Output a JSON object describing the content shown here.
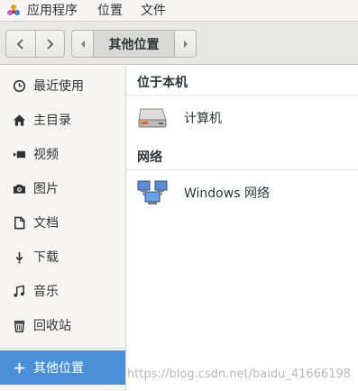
{
  "menubar": {
    "items": [
      "应用程序",
      "位置",
      "文件"
    ]
  },
  "toolbar": {
    "back_icon": "chevron-left-icon",
    "forward_icon": "chevron-right-icon",
    "path": "其他位置"
  },
  "sidebar": {
    "items": [
      {
        "label": "最近使用",
        "icon": "clock-icon"
      },
      {
        "label": "主目录",
        "icon": "home-icon"
      },
      {
        "label": "视频",
        "icon": "video-icon"
      },
      {
        "label": "图片",
        "icon": "camera-icon"
      },
      {
        "label": "文档",
        "icon": "document-icon"
      },
      {
        "label": "下载",
        "icon": "download-icon"
      },
      {
        "label": "音乐",
        "icon": "music-icon"
      },
      {
        "label": "回收站",
        "icon": "trash-icon"
      }
    ],
    "other_locations": {
      "label": "其他位置",
      "icon": "plus-icon"
    }
  },
  "main": {
    "local_section": "位于本机",
    "computer": "计算机",
    "network_section": "网络",
    "network": "Windows 网络"
  },
  "watermark": "https://blog.csdn.net/baidu_41666198",
  "colors": {
    "accent": "#4a90d9",
    "sidebar_bg": "#f6f5f4",
    "toolbar_bg": "#e8e8e7"
  }
}
